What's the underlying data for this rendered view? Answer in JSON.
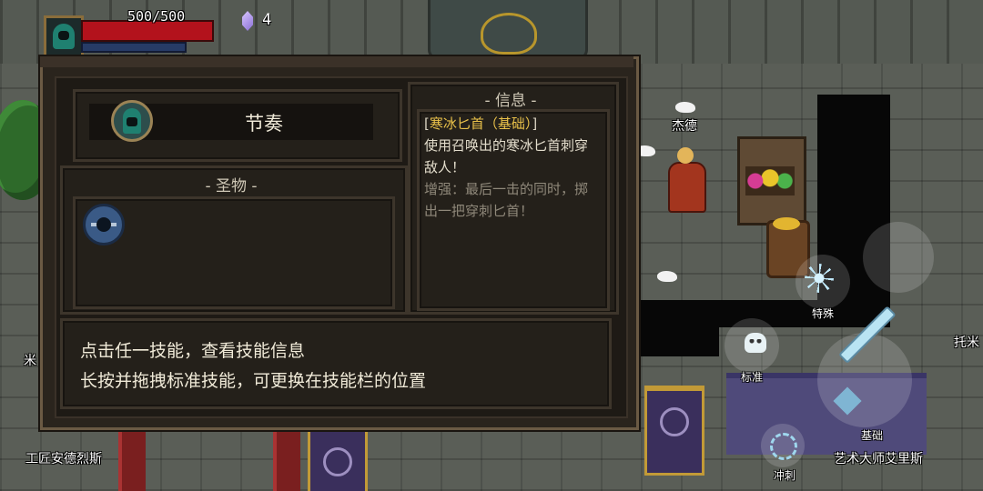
{
  "hud": {
    "hp_text": "500/500",
    "hp_fraction": 1.0,
    "gem_count": "4"
  },
  "dialog": {
    "skill_title": "节奏",
    "relic_section_title": "- 圣物 -",
    "info_section_title": "- 信息 -",
    "info": {
      "bracket_open": "[",
      "skill_name": "寒冰匕首（基础）",
      "bracket_close": "]",
      "description": "使用召唤出的寒冰匕首刺穿敌人！",
      "empowered": "增强：最后一击的同时，掷出一把穿刺匕首！"
    },
    "hints": [
      "点击任一技能，查看技能信息",
      "长按并拖拽标准技能，可更换在技能栏的位置"
    ]
  },
  "npcs": {
    "jed": "杰德",
    "craftsman": "工匠安德烈斯",
    "art_master": "艺术大师艾里斯",
    "left_partial": "米",
    "right_partial": "托米"
  },
  "controls": {
    "special": "特殊",
    "standard": "标准",
    "basic": "基础",
    "dash": "冲刺"
  },
  "colors": {
    "hp": "#b3121c",
    "info_name": "#e9c14a",
    "info_boost": "#8f887a",
    "panel": "#24201a"
  }
}
